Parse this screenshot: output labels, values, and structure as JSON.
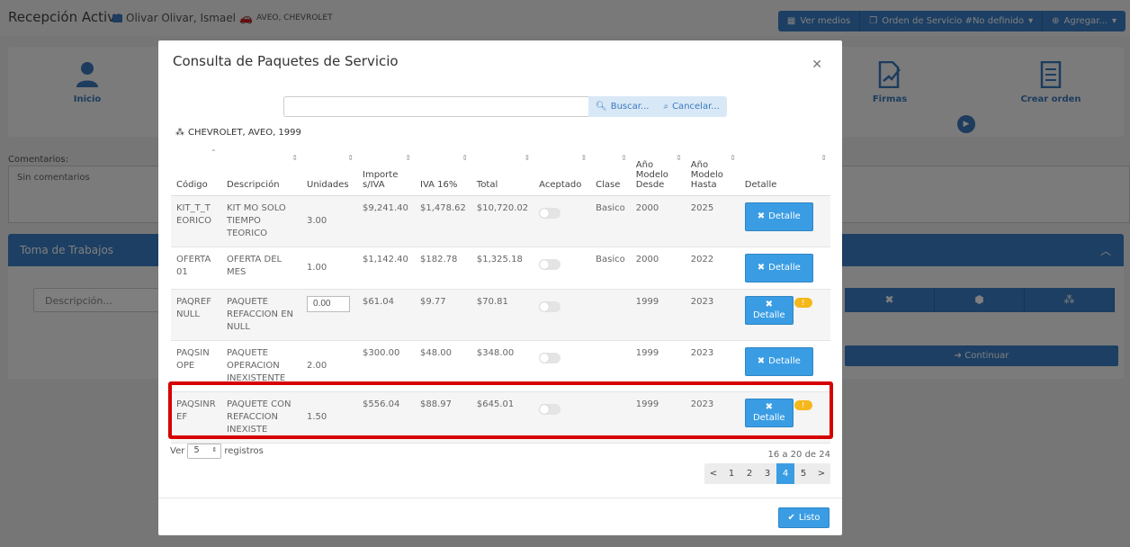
{
  "app": {
    "title": "Recepción Activa",
    "client_name": "Olivar Olivar, Ismael",
    "client_vehicle": "AVEO, CHEVROLET",
    "top_buttons": [
      "Ver medios",
      "Orden de Servicio #No definido",
      "Agregar..."
    ],
    "steps": [
      {
        "label": "Inicio"
      },
      {
        "label": "Firmas"
      },
      {
        "label": "Crear orden"
      }
    ],
    "comments_label": "Comentarios:",
    "comments_value": "Sin comentarios",
    "trabajos_title": "Toma de Trabajos",
    "description_placeholder": "Descripción...",
    "continuar_label": "Continuar"
  },
  "modal": {
    "title": "Consulta de Paquetes de Servicio",
    "search_value": "",
    "search_button": "Buscar...",
    "cancel_button": "Cancelar...",
    "vehicle_info": "CHEVROLET, AVEO, 1999",
    "columns": [
      "Código",
      "Descripción",
      "Unidades",
      "Importe s/IVA",
      "IVA 16%",
      "Total",
      "Aceptado",
      "Clase",
      "Año Modelo Desde",
      "Año Modelo Hasta",
      "Detalle"
    ],
    "rows": [
      {
        "codigo": "KIT_T_TEORICO",
        "descripcion": "KIT MO SOLO TIEMPO TEORICO",
        "unidades": "3.00",
        "importe": "$9,241.40",
        "iva": "$1,478.62",
        "total": "$10,720.02",
        "clase": "Basico",
        "desde": "2000",
        "hasta": "2025",
        "detalle": "Detalle"
      },
      {
        "codigo": "OFERTA01",
        "descripcion": "OFERTA DEL MES",
        "unidades": "1.00",
        "importe": "$1,142.40",
        "iva": "$182.78",
        "total": "$1,325.18",
        "clase": "Basico",
        "desde": "2000",
        "hasta": "2022",
        "detalle": "Detalle"
      },
      {
        "codigo": "PAQREFNULL",
        "descripcion": "PAQUETE REFACCION EN NULL",
        "unidades": "0.00",
        "importe": "$61.04",
        "iva": "$9.77",
        "total": "$70.81",
        "clase": "",
        "desde": "1999",
        "hasta": "2023",
        "detalle": "Detalle"
      },
      {
        "codigo": "PAQSINOPE",
        "descripcion": "PAQUETE OPERACION INEXISTENTE",
        "unidades": "2.00",
        "importe": "$300.00",
        "iva": "$48.00",
        "total": "$348.00",
        "clase": "",
        "desde": "1999",
        "hasta": "2023",
        "detalle": "Detalle"
      },
      {
        "codigo": "PAQSINREF",
        "descripcion": "PAQUETE CON REFACCION INEXISTE",
        "unidades": "1.50",
        "importe": "$556.04",
        "iva": "$88.97",
        "total": "$645.01",
        "clase": "",
        "desde": "1999",
        "hasta": "2023",
        "detalle": "Detalle"
      }
    ],
    "length_prefix": "Ver",
    "length_value": "5",
    "length_suffix": "registros",
    "page_info": "16 a 20 de 24",
    "pagination": [
      "<",
      "1",
      "2",
      "3",
      "4",
      "5",
      ">"
    ],
    "active_page": "4",
    "listo_button": "Listo"
  },
  "colors": {
    "primary": "#3a7fc6",
    "button": "#3a9de4",
    "highlight": "#d60000",
    "warning": "#f5b81c"
  }
}
